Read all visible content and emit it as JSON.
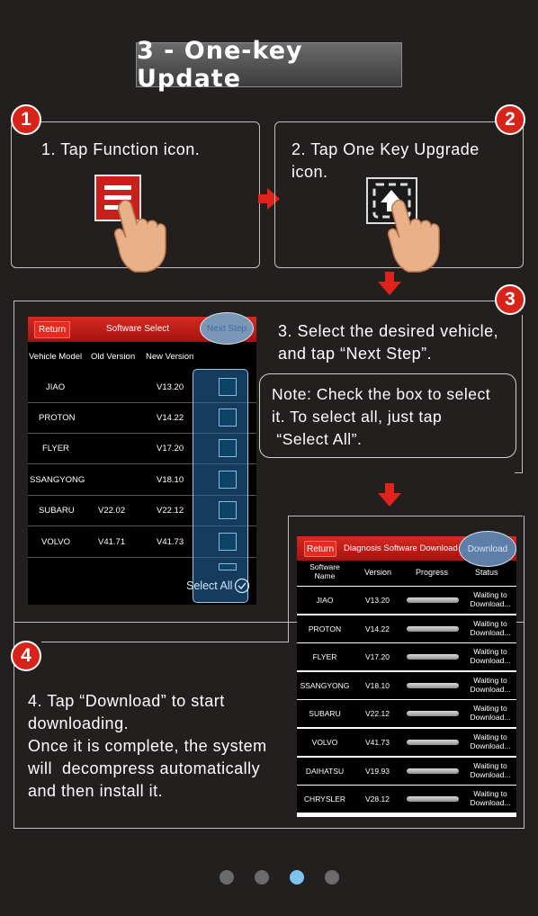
{
  "title": "3 - One-key Update",
  "steps": {
    "s1": {
      "num": "1",
      "text": "1. Tap  Function  icon."
    },
    "s2": {
      "num": "2",
      "text_line1": "2. Tap  One Key Upgrade",
      "text_line2": "icon."
    },
    "s3": {
      "num": "3",
      "text_line1": "3. Select the desired vehicle,",
      "text_line2": "and tap “Next Step”."
    },
    "s4": {
      "num": "4",
      "lines": [
        "4. Tap “Download” to start",
        "downloading.",
        "Once it is complete, the system",
        "will  decompress automatically",
        "and then install it."
      ]
    }
  },
  "note": {
    "lines": [
      "Note: Check the box to select",
      "it. To select all, just tap",
      " “Select All”."
    ]
  },
  "software_select": {
    "return_label": "Return",
    "title": "Software Select",
    "next_label": "Next Step",
    "headers": [
      "Vehicle Model",
      "Old Version",
      "New Version"
    ],
    "rows": [
      {
        "model": "JIAO",
        "old": "",
        "new": "V13.20"
      },
      {
        "model": "PROTON",
        "old": "",
        "new": "V14.22"
      },
      {
        "model": "FLYER",
        "old": "",
        "new": "V17.20"
      },
      {
        "model": "SSANGYONG",
        "old": "",
        "new": "V18.10"
      },
      {
        "model": "SUBARU",
        "old": "V22.02",
        "new": "V22.12"
      },
      {
        "model": "VOLVO",
        "old": "V41.71",
        "new": "V41.73"
      }
    ],
    "select_all_label": "Select All"
  },
  "download_screen": {
    "return_label": "Return",
    "title": "Diagnosis Software Download",
    "download_label": "Download",
    "headers": [
      "Software Name",
      "Version",
      "Progress",
      "Status"
    ],
    "rows": [
      {
        "name": "JIAO",
        "version": "V13.20",
        "status": "Waiting to Download..."
      },
      {
        "name": "PROTON",
        "version": "V14.22",
        "status": "Waiting to Download..."
      },
      {
        "name": "FLYER",
        "version": "V17.20",
        "status": "Waiting to Download..."
      },
      {
        "name": "SSANGYONG",
        "version": "V18.10",
        "status": "Waiting to Download..."
      },
      {
        "name": "SUBARU",
        "version": "V22.12",
        "status": "Waiting to Download..."
      },
      {
        "name": "VOLVO",
        "version": "V41.73",
        "status": "Waiting to Download..."
      },
      {
        "name": "DAIHATSU",
        "version": "V19.93",
        "status": "Waiting to Download..."
      },
      {
        "name": "CHRYSLER",
        "version": "V28.12",
        "status": "Waiting to Download..."
      }
    ]
  },
  "pagination": {
    "total": 4,
    "active_index": 2
  },
  "colors": {
    "background": "#231f1e",
    "accent_red": "#d8231b",
    "highlight_blue": "#7fc4ee"
  },
  "icons": [
    "function-menu-icon",
    "one-key-upgrade-icon",
    "pointing-hand-icon",
    "checkbox-check-icon"
  ]
}
